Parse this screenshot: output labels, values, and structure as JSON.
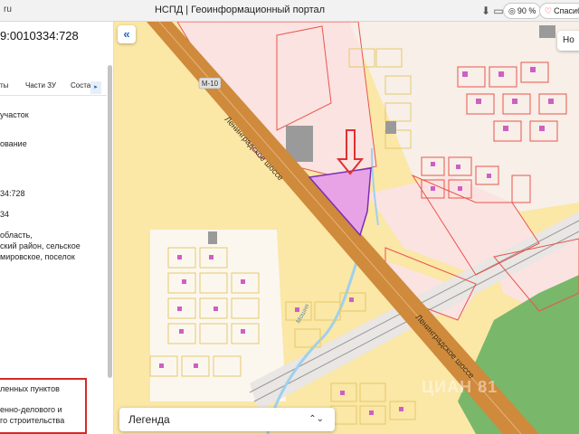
{
  "browser": {
    "url_fragment": "ru",
    "title": "НСПД | Геоинформационный портал",
    "zoom": "90 %",
    "action": "Спасиб"
  },
  "panel": {
    "cadastral_number": "9:0010334:728",
    "tabs": [
      "ты",
      "Части ЗУ",
      "Соста"
    ],
    "lines": [
      "участок",
      "ование",
      "34:728",
      "34",
      "область,",
      "ский район, сельское",
      "мировское, поселок"
    ],
    "highlighted_lines": [
      "ленных пунктов",
      "енно-делового и",
      "го строительства"
    ]
  },
  "map": {
    "road_name": "Ленинградское шоссе",
    "road_code": "М-10",
    "river_name": "Мошня",
    "legend_label": "Легенда",
    "top_right_label": "Но",
    "collapse_icon": "double-chevron-left-icon",
    "watermark": "ЦИАН 81",
    "colors": {
      "zone_yellow": "#fbe7a6",
      "zone_pink": "#fbe3e1",
      "parcel_outline": "#e8554e",
      "road": "#cf8a3c",
      "selected_parcel": "#e7a3e6",
      "forest": "#79b76b",
      "arrow": "#e03030"
    }
  }
}
